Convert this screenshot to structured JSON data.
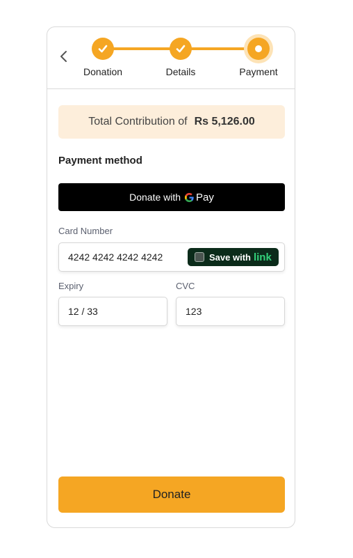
{
  "stepper": {
    "steps": [
      {
        "label": "Donation",
        "state": "completed"
      },
      {
        "label": "Details",
        "state": "completed"
      },
      {
        "label": "Payment",
        "state": "active"
      }
    ],
    "back_icon": "chevron-left-icon",
    "completed_icon": "check-icon"
  },
  "summary": {
    "label": "Total Contribution of",
    "amount": "Rs 5,126.00"
  },
  "payment": {
    "section_title": "Payment method",
    "gpay_label": "Donate with",
    "gpay_brand": "Pay"
  },
  "card_form": {
    "card_number_label": "Card Number",
    "card_number_value": "4242 4242 4242 4242",
    "link_label": "Save with",
    "link_brand": "link",
    "link_checked": false,
    "expiry_label": "Expiry",
    "expiry_value": "12 / 33",
    "cvc_label": "CVC",
    "cvc_value": "123"
  },
  "donate_button": "Donate",
  "colors": {
    "accent": "#f5a623",
    "accent_light": "#fdeedb",
    "link_bg": "#0b2b1a",
    "link_green": "#33d17a"
  }
}
